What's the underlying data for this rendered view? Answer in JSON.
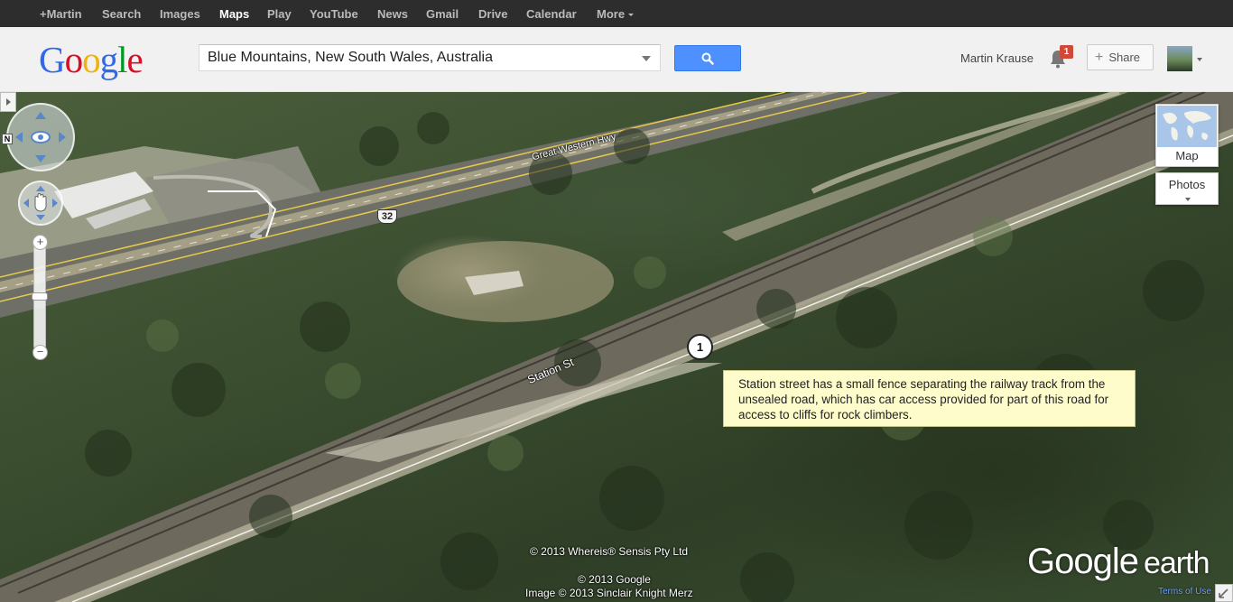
{
  "nav": {
    "items": [
      {
        "label": "+Martin",
        "active": false
      },
      {
        "label": "Search",
        "active": false
      },
      {
        "label": "Images",
        "active": false
      },
      {
        "label": "Maps",
        "active": true
      },
      {
        "label": "Play",
        "active": false
      },
      {
        "label": "YouTube",
        "active": false
      },
      {
        "label": "News",
        "active": false
      },
      {
        "label": "Gmail",
        "active": false
      },
      {
        "label": "Drive",
        "active": false
      },
      {
        "label": "Calendar",
        "active": false
      }
    ],
    "more_label": "More"
  },
  "header": {
    "logo_letters": [
      {
        "ch": "G",
        "color": "#3369e8"
      },
      {
        "ch": "o",
        "color": "#d50f25"
      },
      {
        "ch": "o",
        "color": "#eeb211"
      },
      {
        "ch": "g",
        "color": "#3369e8"
      },
      {
        "ch": "l",
        "color": "#009925"
      },
      {
        "ch": "e",
        "color": "#d50f25"
      }
    ],
    "search_value": "Blue Mountains, New South Wales, Australia",
    "user_name": "Martin Krause",
    "notification_count": "1",
    "share_label": "Share"
  },
  "map": {
    "map_type_map": "Map",
    "map_type_photos": "Photos",
    "marker_label": "1",
    "note_text": "Station street has a small fence separating the railway track from the unsealed road, which has car access provided for part of this road for access to cliffs for rock climbers.",
    "road_labels": {
      "highway": "Great Western Hwy",
      "station": "Station St",
      "route_shield": "32"
    },
    "copyright": {
      "whereis": "© 2013 Whereis® Sensis Pty Ltd",
      "google": "© 2013 Google",
      "image": "Image © 2013 Sinclair Knight Merz"
    },
    "logo_google": "Google",
    "logo_earth": "earth",
    "terms_label": "Terms of Use"
  },
  "colors": {
    "accent_blue": "#4d90fe",
    "badge_red": "#d14836",
    "note_bg": "#fffccc"
  }
}
